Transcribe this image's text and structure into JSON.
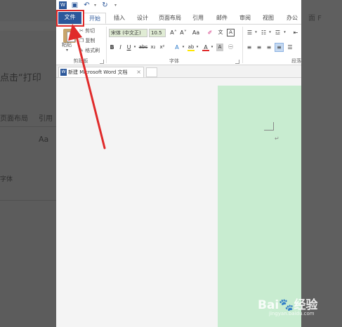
{
  "quick_access": {
    "save_icon": "save-icon",
    "undo_icon": "undo-icon",
    "redo_icon": "redo-icon",
    "customize_icon": "chevron-down-icon"
  },
  "tabs": [
    {
      "label": "文件"
    },
    {
      "label": "开始"
    },
    {
      "label": "插入"
    },
    {
      "label": "设计"
    },
    {
      "label": "页面布局"
    },
    {
      "label": "引用"
    },
    {
      "label": "邮件"
    },
    {
      "label": "审阅"
    },
    {
      "label": "视图"
    },
    {
      "label": "办公"
    }
  ],
  "clipboard": {
    "paste_label": "粘贴",
    "cut_label": "剪切",
    "copy_label": "复制",
    "format_painter_label": "格式刷",
    "group_label": "剪贴板"
  },
  "font": {
    "family": "宋体 (中文正)",
    "size": "10.5",
    "bold": "B",
    "italic": "I",
    "underline": "U",
    "strike": "abc",
    "subscript": "x₂",
    "superscript": "x²",
    "grow": "A˄",
    "shrink": "A˅",
    "case": "Aa",
    "group_label": "字体"
  },
  "paragraph": {
    "group_label": "段落"
  },
  "document_tab": {
    "title": "新建 Microsoft Word 文档",
    "close": "×",
    "icon_text": "W"
  },
  "background_text": {
    "left_heading": "点击“打印",
    "left_tab1": "页面布局",
    "left_tab2": "引用",
    "left_font_label": "字体",
    "right_text": "面 F",
    "left_aa": "Aa"
  },
  "watermark": {
    "text": "Bai",
    "text2": "经验",
    "sub": "jingyan.baidu.com"
  },
  "colors": {
    "accent": "#2b579a",
    "highlight": "#e02a2a",
    "page": "#c8ecd0"
  }
}
